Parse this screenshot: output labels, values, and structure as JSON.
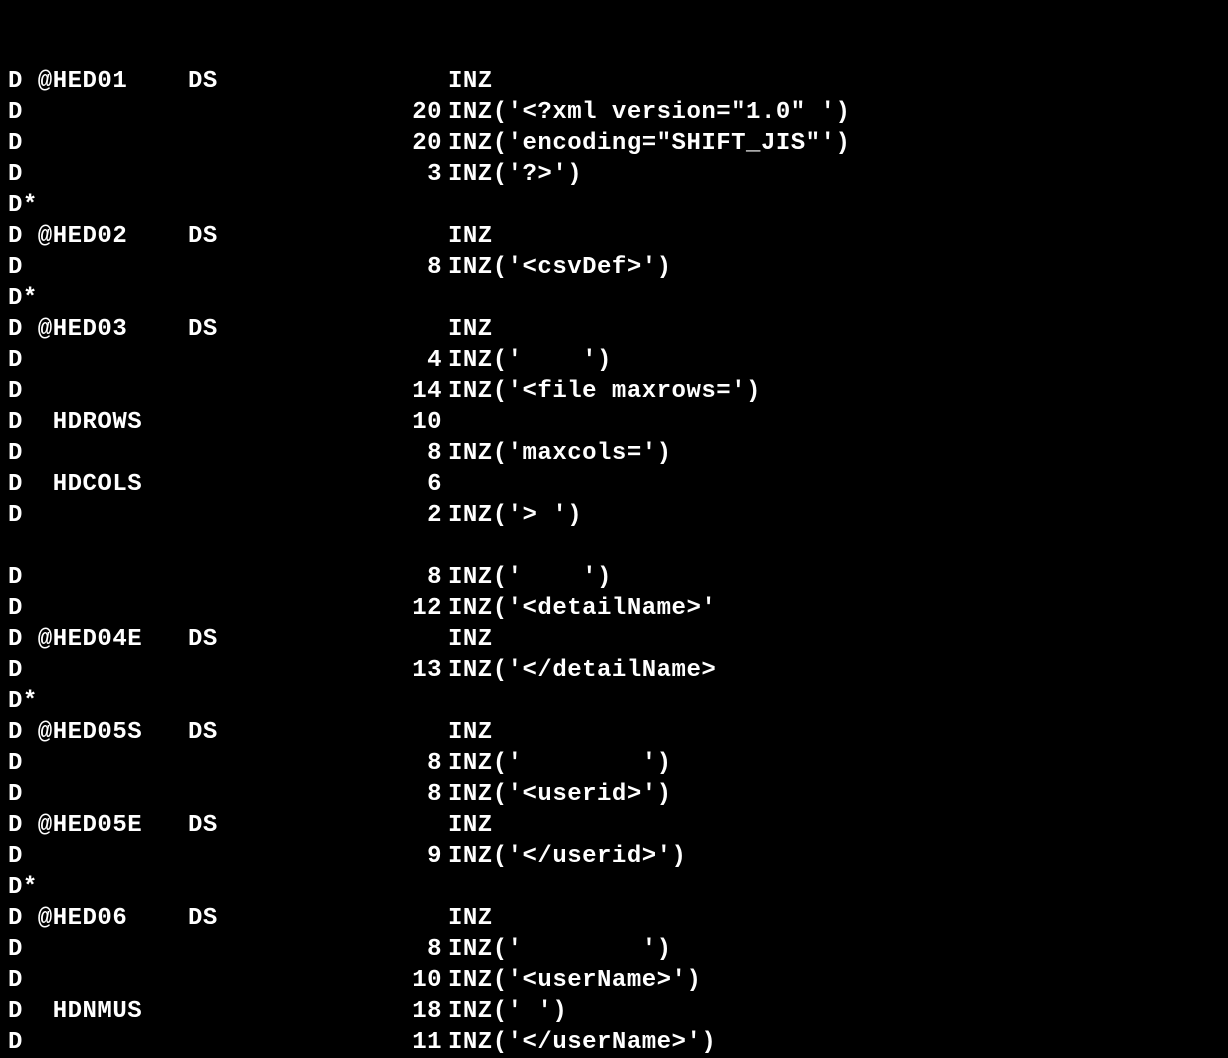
{
  "rows": [
    {
      "c1": "D @HED01",
      "c2": "DS",
      "c3": "",
      "c4": "INZ"
    },
    {
      "c1": "D",
      "c2": "",
      "c3": "20",
      "c4": "INZ('<?xml version=\"1.0\" ')"
    },
    {
      "c1": "D",
      "c2": "",
      "c3": "20",
      "c4": "INZ('encoding=\"SHIFT_JIS\"')"
    },
    {
      "c1": "D",
      "c2": "",
      "c3": "3",
      "c4": "INZ('?>')"
    },
    {
      "c1": "D*",
      "c2": "",
      "c3": "",
      "c4": ""
    },
    {
      "c1": "D @HED02",
      "c2": "DS",
      "c3": "",
      "c4": "INZ"
    },
    {
      "c1": "D",
      "c2": "",
      "c3": "8",
      "c4": "INZ('<csvDef>')"
    },
    {
      "c1": "D*",
      "c2": "",
      "c3": "",
      "c4": ""
    },
    {
      "c1": "D @HED03",
      "c2": "DS",
      "c3": "",
      "c4": "INZ"
    },
    {
      "c1": "D",
      "c2": "",
      "c3": "4",
      "c4": "INZ('    ')"
    },
    {
      "c1": "D",
      "c2": "",
      "c3": "14",
      "c4": "INZ('<file maxrows=')"
    },
    {
      "c1": "D  HDROWS",
      "c2": "",
      "c3": "10",
      "c4": ""
    },
    {
      "c1": "D",
      "c2": "",
      "c3": "8",
      "c4": "INZ('maxcols=')"
    },
    {
      "c1": "D  HDCOLS",
      "c2": "",
      "c3": "6",
      "c4": ""
    },
    {
      "c1": "D",
      "c2": "",
      "c3": "2",
      "c4": "INZ('> ')"
    },
    {
      "c1": "",
      "c2": "",
      "c3": "",
      "c4": ""
    },
    {
      "c1": "D",
      "c2": "",
      "c3": "8",
      "c4": "INZ('    ')"
    },
    {
      "c1": "D",
      "c2": "",
      "c3": "12",
      "c4": "INZ('<detailName>'"
    },
    {
      "c1": "D @HED04E",
      "c2": "DS",
      "c3": "",
      "c4": "INZ"
    },
    {
      "c1": "D",
      "c2": "",
      "c3": "13",
      "c4": "INZ('</detailName>"
    },
    {
      "c1": "D*",
      "c2": "",
      "c3": "",
      "c4": ""
    },
    {
      "c1": "D @HED05S",
      "c2": "DS",
      "c3": "",
      "c4": "INZ"
    },
    {
      "c1": "D",
      "c2": "",
      "c3": "8",
      "c4": "INZ('        ')"
    },
    {
      "c1": "D",
      "c2": "",
      "c3": "8",
      "c4": "INZ('<userid>')"
    },
    {
      "c1": "D @HED05E",
      "c2": "DS",
      "c3": "",
      "c4": "INZ"
    },
    {
      "c1": "D",
      "c2": "",
      "c3": "9",
      "c4": "INZ('</userid>')"
    },
    {
      "c1": "D*",
      "c2": "",
      "c3": "",
      "c4": ""
    },
    {
      "c1": "D @HED06",
      "c2": "DS",
      "c3": "",
      "c4": "INZ"
    },
    {
      "c1": "D",
      "c2": "",
      "c3": "8",
      "c4": "INZ('        ')"
    },
    {
      "c1": "D",
      "c2": "",
      "c3": "10",
      "c4": "INZ('<userName>')"
    },
    {
      "c1": "D  HDNMUS",
      "c2": "",
      "c3": "18",
      "c4": "INZ(' ')"
    },
    {
      "c1": "D",
      "c2": "",
      "c3": "11",
      "c4": "INZ('</userName>')"
    }
  ]
}
